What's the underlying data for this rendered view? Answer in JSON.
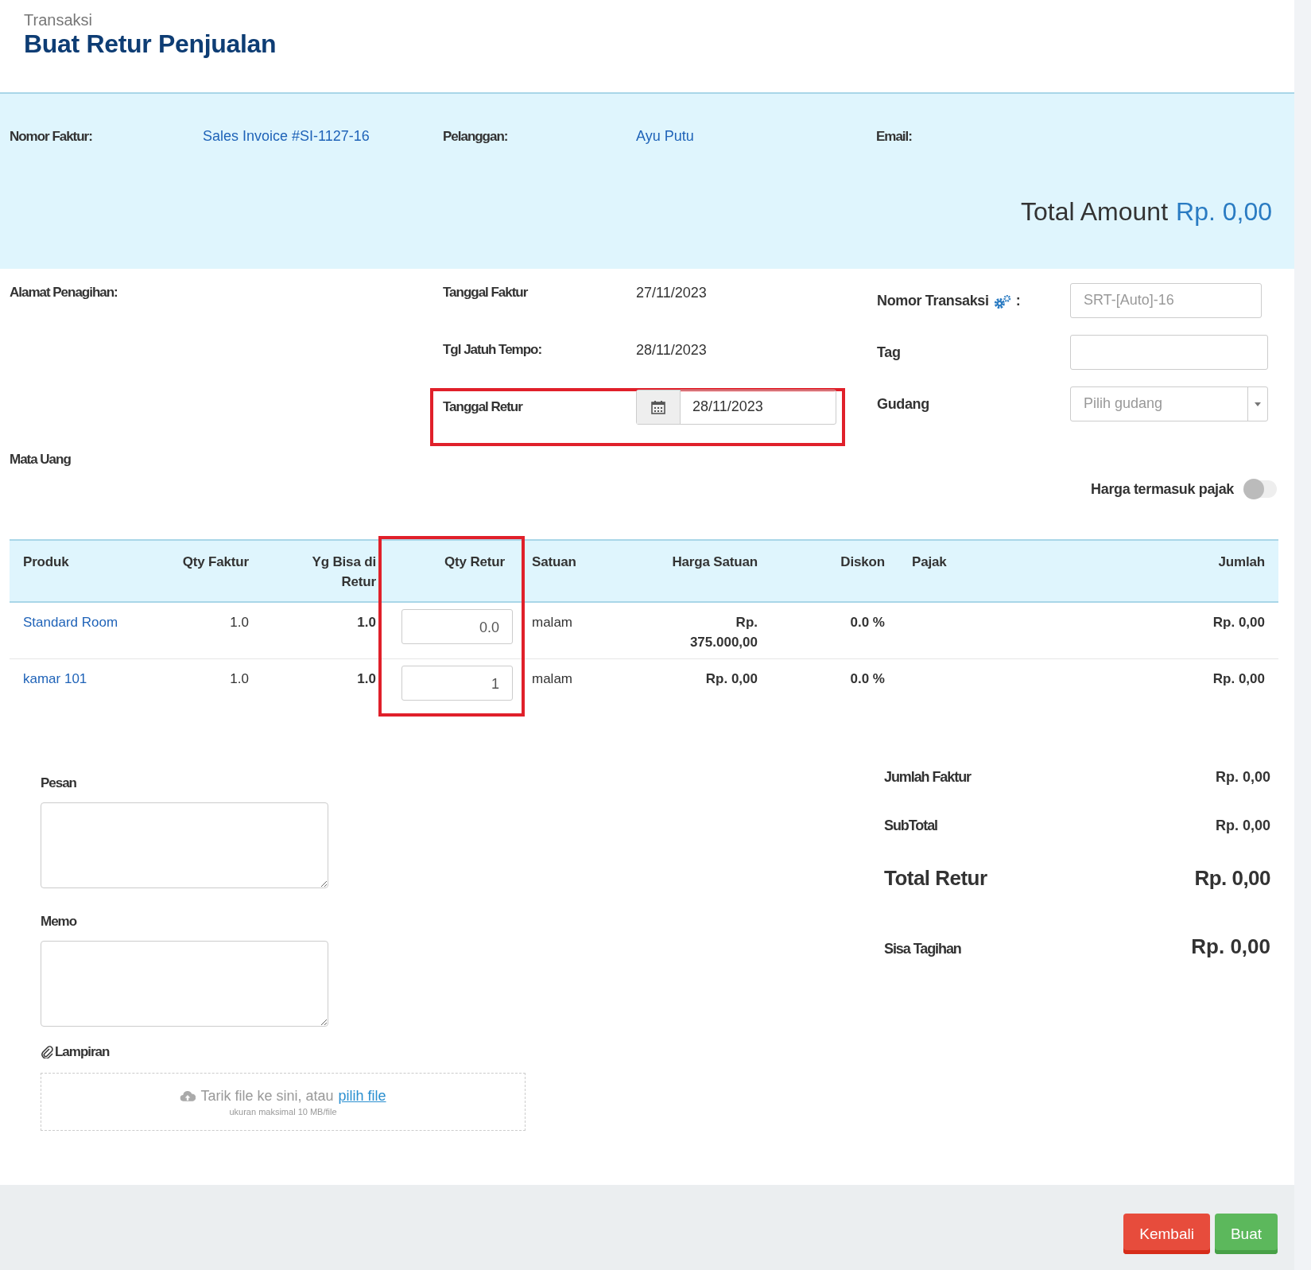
{
  "header": {
    "breadcrumb": "Transaksi",
    "title": "Buat Retur Penjualan"
  },
  "info": {
    "fields": [
      {
        "label": "Nomor Faktur:",
        "value": "Sales Invoice #SI-1127-16"
      },
      {
        "label": "Pelanggan:",
        "value": "Ayu Putu"
      },
      {
        "label": "Email:"
      }
    ],
    "total_label": "Total Amount",
    "total_value": "Rp. 0,00"
  },
  "details": {
    "billing_label": "Alamat Penagihan:",
    "dates": [
      {
        "kind": "text",
        "label": "Tanggal Faktur",
        "value": "27/11/2023",
        "highlighted": false
      },
      {
        "kind": "text",
        "label": "Tgl Jatuh Tempo:",
        "value": "28/11/2023",
        "highlighted": false
      },
      {
        "kind": "date",
        "label": "Tanggal Retur",
        "value": "28/11/2023",
        "highlighted": true
      }
    ],
    "fields": [
      {
        "kind": "input",
        "label": "Nomor Transaksi",
        "settings_icon": true,
        "suffix": ":",
        "placeholder": "SRT-[Auto]-16"
      },
      {
        "kind": "input",
        "label": "Tag",
        "settings_icon": false
      },
      {
        "kind": "select",
        "label": "Gudang",
        "settings_icon": false,
        "placeholder": "Pilih gudang"
      }
    ],
    "currency_label": "Mata Uang",
    "tax_toggle": {
      "label": "Harga termasuk pajak",
      "on": false
    }
  },
  "table": {
    "columns": [
      {
        "label": "Produk",
        "highlighted": false
      },
      {
        "label": "Qty Faktur",
        "highlighted": false
      },
      {
        "label": "Yg Bisa di Retur",
        "highlighted": false
      },
      {
        "label": "Qty Retur",
        "highlighted": true
      },
      {
        "label": "Satuan",
        "highlighted": false
      },
      {
        "label": "Harga Satuan",
        "highlighted": false
      },
      {
        "label": "Diskon",
        "highlighted": false
      },
      {
        "label": "Pajak",
        "highlighted": false
      },
      {
        "label": "Jumlah",
        "highlighted": false
      }
    ],
    "rows": [
      {
        "product": "Standard Room",
        "qty_invoice": "1.0",
        "returnable": "1.0",
        "qty_return": "0.0",
        "unit": "malam",
        "unit_price": "Rp. 375.000,00",
        "discount": "0.0 %",
        "amount": "Rp. 0,00"
      },
      {
        "product": "kamar 101",
        "qty_invoice": "1.0",
        "returnable": "1.0",
        "qty_return": "1",
        "unit": "malam",
        "unit_price": "Rp. 0,00",
        "discount": "0.0 %",
        "amount": "Rp. 0,00"
      }
    ]
  },
  "notes": {
    "message_label": "Pesan",
    "memo_label": "Memo",
    "attachment_label": "Lampiran",
    "dropzone_text": "Tarik file ke sini, atau",
    "dropzone_link": "pilih file",
    "dropzone_hint": "ukuran maksimal 10 MB/file"
  },
  "summary": [
    {
      "kind": "small",
      "label": "Jumlah Faktur",
      "value": "Rp. 0,00"
    },
    {
      "kind": "small",
      "label": "SubTotal",
      "value": "Rp. 0,00"
    },
    {
      "kind": "large",
      "label": "Total Retur",
      "value": "Rp. 0,00"
    },
    {
      "kind": "mixed",
      "label": "Sisa Tagihan",
      "value": "Rp. 0,00"
    }
  ],
  "buttons": [
    {
      "kind": "danger",
      "label": "Kembali"
    },
    {
      "kind": "success",
      "label": "Buat"
    }
  ]
}
